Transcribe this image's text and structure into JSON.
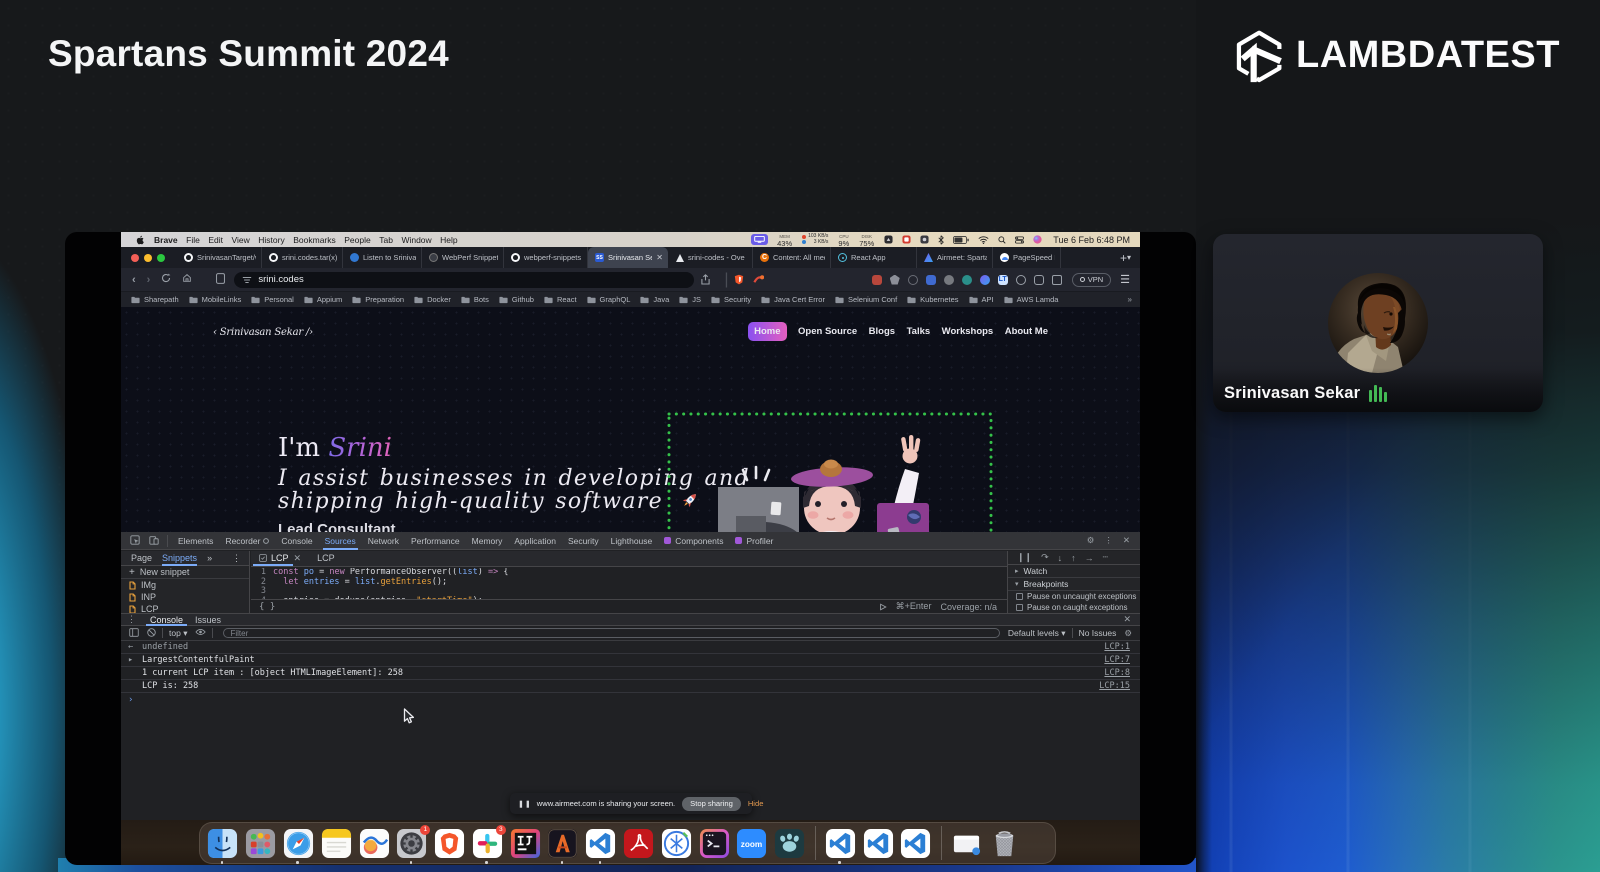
{
  "stage": {
    "title": "Spartans Summit 2024",
    "brand": "LAMBDATEST"
  },
  "participant": {
    "name": "Srinivasan Sekar"
  },
  "macos": {
    "menubar": {
      "app": "Brave",
      "items": [
        "File",
        "Edit",
        "View",
        "History",
        "Bookmarks",
        "People",
        "Tab",
        "Window",
        "Help"
      ],
      "stats": {
        "mem": "43%",
        "net_up": "103 KB/s",
        "net_down": "3 KB/s",
        "cpu": "9%",
        "disk": "75%"
      },
      "clock": "Tue 6 Feb  6:48 PM"
    },
    "sharing": {
      "message": "www.airmeet.com is sharing your screen.",
      "stop_label": "Stop sharing",
      "hide_label": "Hide"
    },
    "dock": {
      "apps": [
        "Finder",
        "Launchpad",
        "Safari",
        "Notes",
        "Freeform",
        "System Settings",
        "Brave",
        "Slack",
        "IntelliJ IDEA",
        "Warp",
        "VS Code",
        "Acrobat",
        "Xcode",
        "Terminal",
        "Zoom",
        "Paw",
        "VS Code Window",
        "VS Code Window",
        "VS Code Window",
        "Minimized Window",
        "Trash"
      ],
      "settings_badge": "1",
      "slack_badge": "3"
    }
  },
  "browser": {
    "tabs": [
      {
        "label": "SrinivasanTarget/w",
        "icon": "github",
        "active": false
      },
      {
        "label": "srini.codes.tar(x)c",
        "icon": "github",
        "active": false
      },
      {
        "label": "Listen to Srinivasa",
        "icon": "blue",
        "active": false
      },
      {
        "label": "WebPerf Snippets",
        "icon": "darkdot",
        "active": false
      },
      {
        "label": "webperf-snippets",
        "icon": "github",
        "active": false
      },
      {
        "label": "Srinivasan Sek",
        "icon": "ss",
        "active": true
      },
      {
        "label": "srini-codes - Ove",
        "icon": "tri",
        "active": false
      },
      {
        "label": "Content: All media",
        "icon": "c",
        "active": false
      },
      {
        "label": "React App",
        "icon": "react",
        "active": false
      },
      {
        "label": "Airmeet: Sparta",
        "icon": "airmeet",
        "active": false
      },
      {
        "label": "PageSpeed Insigh",
        "icon": "psi",
        "active": false
      }
    ],
    "url": "srini.codes",
    "vpn_label": "VPN",
    "bookmarks": [
      "Sharepath",
      "MobileLinks",
      "Personal",
      "Appium",
      "Preparation",
      "Docker",
      "Bots",
      "Github",
      "React",
      "GraphQL",
      "Java",
      "JS",
      "Security",
      "Java Cert Error",
      "Selenium Conf",
      "Kubernetes",
      "API",
      "AWS Lamda"
    ]
  },
  "site": {
    "logo": "‹ Srinivasan Sekar /›",
    "nav": [
      "Home",
      "Open Source",
      "Blogs",
      "Talks",
      "Workshops",
      "About Me"
    ],
    "hero_prefix": "I'm ",
    "hero_name": "Srini",
    "tagline_line1": "I assist businesses in developing and",
    "tagline_line2": "shipping high-quality software",
    "role": "Lead Consultant"
  },
  "devtools": {
    "tabs": [
      {
        "label": "Elements",
        "active": false,
        "dot": false
      },
      {
        "label": "Recorder",
        "active": false,
        "dot": false
      },
      {
        "label": "Console",
        "active": false,
        "dot": false
      },
      {
        "label": "Sources",
        "active": true,
        "dot": false
      },
      {
        "label": "Network",
        "active": false,
        "dot": false
      },
      {
        "label": "Performance",
        "active": false,
        "dot": false
      },
      {
        "label": "Memory",
        "active": false,
        "dot": false
      },
      {
        "label": "Application",
        "active": false,
        "dot": false
      },
      {
        "label": "Security",
        "active": false,
        "dot": false
      },
      {
        "label": "Lighthouse",
        "active": false,
        "dot": false
      },
      {
        "label": "Components",
        "active": false,
        "dot": true
      },
      {
        "label": "Profiler",
        "active": false,
        "dot": true
      }
    ],
    "left_tabs": [
      "Page",
      "Snippets"
    ],
    "new_snippet": "New snippet",
    "snippets": [
      "IMg",
      "INP",
      "LCP"
    ],
    "editor_tabs": [
      "LCP",
      "LCP"
    ],
    "code_lines": [
      {
        "n": "1",
        "tokens": [
          {
            "t": "const ",
            "c": "tok-k"
          },
          {
            "t": "po",
            "c": "tok-v"
          },
          {
            "t": " = ",
            "c": "tok-p"
          },
          {
            "t": "new ",
            "c": "tok-k"
          },
          {
            "t": "PerformanceObserver",
            "c": "tok-p"
          },
          {
            "t": "((",
            "c": "tok-p"
          },
          {
            "t": "list",
            "c": "tok-v"
          },
          {
            "t": ") ",
            "c": "tok-p"
          },
          {
            "t": "=>",
            "c": "tok-k"
          },
          {
            "t": " {",
            "c": "tok-p"
          }
        ]
      },
      {
        "n": "2",
        "tokens": [
          {
            "t": "  let ",
            "c": "tok-k"
          },
          {
            "t": "entries",
            "c": "tok-v"
          },
          {
            "t": " = ",
            "c": "tok-p"
          },
          {
            "t": "list",
            "c": "tok-v"
          },
          {
            "t": ".",
            "c": "tok-p"
          },
          {
            "t": "getEntries",
            "c": "tok-f"
          },
          {
            "t": "();",
            "c": "tok-p"
          }
        ]
      },
      {
        "n": "3",
        "tokens": [
          {
            "t": "",
            "c": "tok-p"
          }
        ]
      },
      {
        "n": "4",
        "tokens": [
          {
            "t": "  entries = dedupe(entries, ",
            "c": "tok-p"
          },
          {
            "t": "\"startTime\"",
            "c": "tok-s"
          },
          {
            "t": ");",
            "c": "tok-p"
          }
        ]
      }
    ],
    "braces": "{ }",
    "shortcut": "⌘+Enter",
    "coverage": "Coverage: n/a",
    "watch": "Watch",
    "breakpoints": "Breakpoints",
    "pause_uncaught": "Pause on uncaught exceptions",
    "pause_caught": "Pause on caught exceptions",
    "console": {
      "tabs": [
        "Console",
        "Issues"
      ],
      "context": "top",
      "filter_placeholder": "Filter",
      "levels": "Default levels",
      "no_issues": "No Issues",
      "messages": [
        {
          "icon": "←",
          "text": "undefined",
          "muted": true,
          "link": "LCP:1"
        },
        {
          "icon": "▸",
          "text": "LargestContentfulPaint",
          "muted": false,
          "link": "LCP:7"
        },
        {
          "icon": "",
          "text": "1 current LCP item : [object HTMLImageElement]: 258",
          "muted": false,
          "link": "LCP:8"
        },
        {
          "icon": "",
          "text": "LCP is: 258",
          "muted": false,
          "link": "LCP:15"
        }
      ]
    }
  }
}
